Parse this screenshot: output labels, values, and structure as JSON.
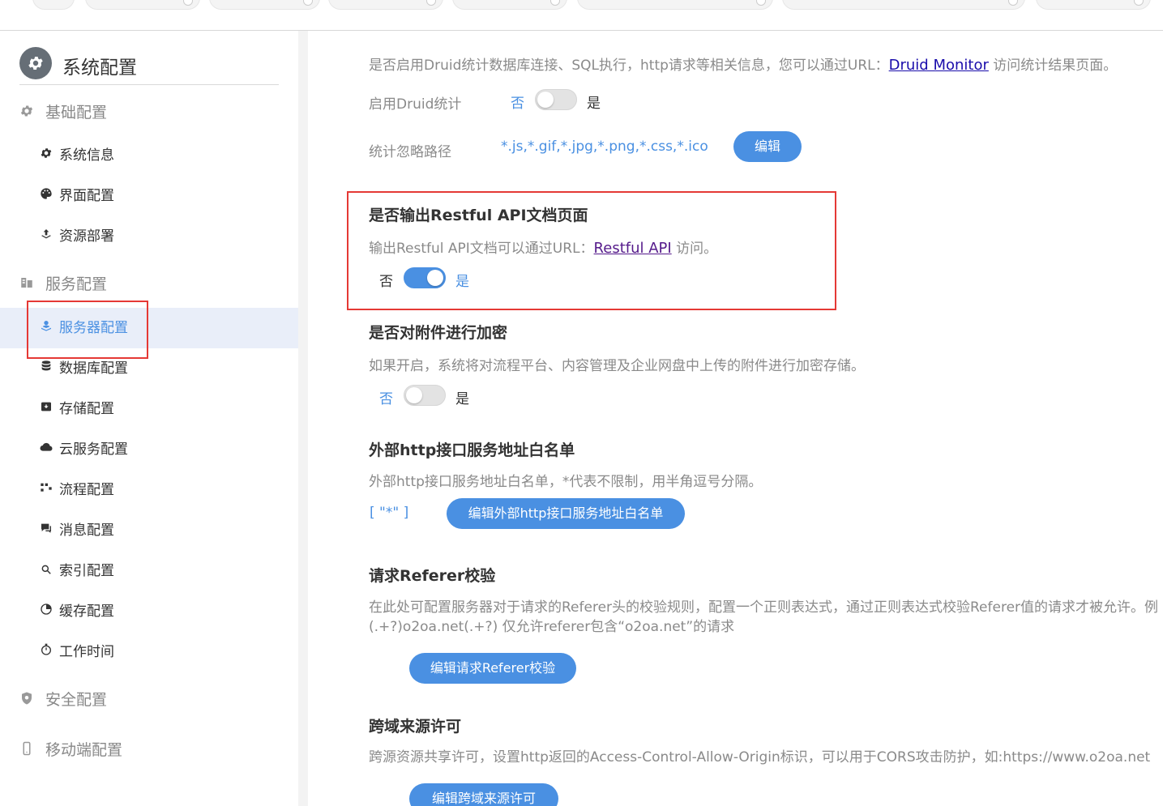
{
  "sidebar": {
    "title": "系统配置",
    "groups": [
      {
        "label": "基础配置",
        "icon": "gear-icon"
      },
      {
        "label": "服务配置",
        "icon": "server-icon"
      },
      {
        "label": "安全配置",
        "icon": "shield-icon"
      },
      {
        "label": "移动端配置",
        "icon": "mobile-icon"
      }
    ],
    "items": [
      {
        "label": "系统信息",
        "icon": "gear-icon"
      },
      {
        "label": "界面配置",
        "icon": "palette-icon"
      },
      {
        "label": "资源部署",
        "icon": "upload-icon"
      },
      {
        "label": "服务器配置",
        "icon": "server-user-icon",
        "active": true
      },
      {
        "label": "数据库配置",
        "icon": "database-icon"
      },
      {
        "label": "存储配置",
        "icon": "archive-icon"
      },
      {
        "label": "云服务配置",
        "icon": "cloud-icon"
      },
      {
        "label": "流程配置",
        "icon": "flow-icon"
      },
      {
        "label": "消息配置",
        "icon": "message-icon"
      },
      {
        "label": "索引配置",
        "icon": "search-icon"
      },
      {
        "label": "缓存配置",
        "icon": "pie-icon"
      },
      {
        "label": "工作时间",
        "icon": "stopwatch-icon"
      }
    ]
  },
  "main": {
    "druid": {
      "desc_prefix": "是否启用Druid统计数据库连接、SQL执行，http请求等相关信息，您可以通过URL：",
      "desc_link": "Druid Monitor",
      "desc_suffix": " 访问统计结果页面。",
      "enable_label": "启用Druid统计",
      "no": "否",
      "yes": "是",
      "enabled": false,
      "ignore_label": "统计忽略路径",
      "ignore_value": "*.js,*.gif,*.jpg,*.png,*.css,*.ico",
      "edit_button": "编辑"
    },
    "restful": {
      "heading": "是否输出Restful API文档页面",
      "desc_prefix": "输出Restful API文档可以通过URL：",
      "desc_link": "Restful API",
      "desc_suffix": " 访问。",
      "no": "否",
      "yes": "是",
      "enabled": true
    },
    "encrypt": {
      "heading": "是否对附件进行加密",
      "desc": "如果开启，系统将对流程平台、内容管理及企业网盘中上传的附件进行加密存储。",
      "no": "否",
      "yes": "是",
      "enabled": false
    },
    "whitelist": {
      "heading": "外部http接口服务地址白名单",
      "desc": "外部http接口服务地址白名单，*代表不限制，用半角逗号分隔。",
      "value": "[ \"*\" ]",
      "edit_button": "编辑外部http接口服务地址白名单"
    },
    "referer": {
      "heading": "请求Referer校验",
      "desc_line1": "在此处可配置服务器对于请求的Referer头的校验规则，配置一个正则表达式，通过正则表达式校验Referer值的请求才被允许。例",
      "desc_line2": "(.+?)o2oa.net(.+?) 仅允许referer包含“o2oa.net”的请求",
      "edit_button": "编辑请求Referer校验"
    },
    "cors": {
      "heading": "跨域来源许可",
      "desc": "跨源资源共享许可，设置http返回的Access-Control-Allow-Origin标识，可以用于CORS攻击防护，如:https://www.o2oa.net",
      "edit_button": "编辑跨域来源许可"
    }
  }
}
